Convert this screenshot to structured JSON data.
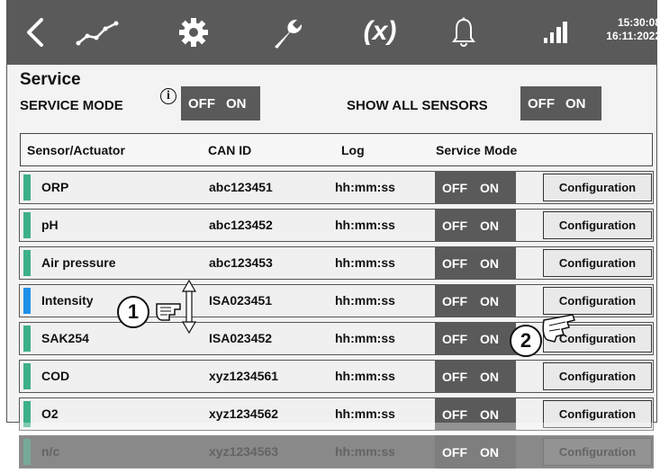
{
  "topbar": {
    "icons": [
      "back-icon",
      "trend-icon",
      "gear-icon",
      "wrench-icon",
      "bell-icon",
      "signal-icon"
    ],
    "variable_label": "(x)",
    "time": "15:30:08",
    "date": "16:11:2022"
  },
  "page": {
    "title": "Service",
    "service_mode_label": "SERVICE MODE",
    "info_glyph": "i",
    "show_all_label": "SHOW ALL SENSORS",
    "toggle_off": "OFF",
    "toggle_on": "ON"
  },
  "table": {
    "headers": [
      "Sensor/Actuator",
      "CAN ID",
      "Log",
      "Service Mode"
    ],
    "rows": [
      {
        "name": "ORP",
        "can_id": "abc123451",
        "log": "hh:mm:ss",
        "off": "OFF",
        "on": "ON",
        "config": "Configuration",
        "indicator": "#3db088"
      },
      {
        "name": "pH",
        "can_id": "abc123452",
        "log": "hh:mm:ss",
        "off": "OFF",
        "on": "ON",
        "config": "Configuration",
        "indicator": "#3db088"
      },
      {
        "name": "Air pressure",
        "can_id": "abc123453",
        "log": "hh:mm:ss",
        "off": "OFF",
        "on": "ON",
        "config": "Configuration",
        "indicator": "#3db088"
      },
      {
        "name": "Intensity",
        "can_id": "ISA023451",
        "log": "hh:mm:ss",
        "off": "OFF",
        "on": "ON",
        "config": "Configuration",
        "indicator": "#1e90e8"
      },
      {
        "name": "SAK254",
        "can_id": "ISA023452",
        "log": "hh:mm:ss",
        "off": "OFF",
        "on": "ON",
        "config": "Configuration",
        "indicator": "#3db088"
      },
      {
        "name": "COD",
        "can_id": "xyz1234561",
        "log": "hh:mm:ss",
        "off": "OFF",
        "on": "ON",
        "config": "Configuration",
        "indicator": "#3db088"
      },
      {
        "name": "O2",
        "can_id": "xyz1234562",
        "log": "hh:mm:ss",
        "off": "OFF",
        "on": "ON",
        "config": "Configuration",
        "indicator": "#3db088"
      },
      {
        "name": "n/c",
        "can_id": "xyz1234563",
        "log": "hh:mm:ss",
        "off": "OFF",
        "on": "ON",
        "config": "Configuration",
        "indicator": "#2f7d62"
      }
    ]
  },
  "callouts": [
    "1",
    "2"
  ],
  "colors": {
    "bar": "#5a5a5a",
    "accent_green": "#3db088",
    "accent_blue": "#1e90e8"
  }
}
